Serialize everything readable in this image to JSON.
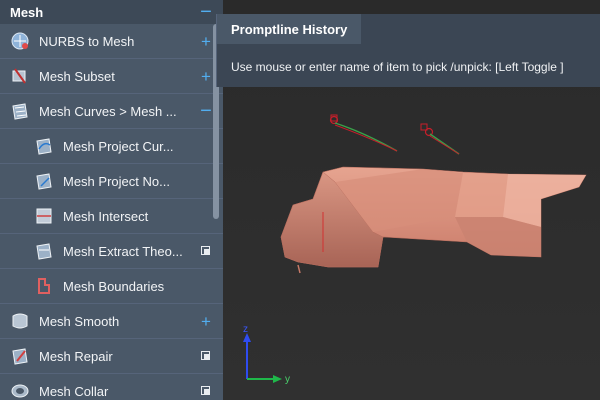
{
  "panel": {
    "title": "Mesh",
    "items": [
      {
        "label": "NURBS to Mesh",
        "action": "plus",
        "icon": "nurbs-to-mesh-icon",
        "sub": false
      },
      {
        "label": "Mesh Subset",
        "action": "plus",
        "icon": "mesh-subset-icon",
        "sub": false
      },
      {
        "label": "Mesh Curves > Mesh ...",
        "action": "minus",
        "icon": "mesh-curves-icon",
        "sub": false
      },
      {
        "label": "Mesh Project Cur...",
        "action": "",
        "icon": "mesh-project-curve-icon",
        "sub": true
      },
      {
        "label": "Mesh Project No...",
        "action": "",
        "icon": "mesh-project-normal-icon",
        "sub": true
      },
      {
        "label": "Mesh Intersect",
        "action": "",
        "icon": "mesh-intersect-icon",
        "sub": true
      },
      {
        "label": "Mesh Extract Theo...",
        "action": "copy",
        "icon": "mesh-extract-icon",
        "sub": true
      },
      {
        "label": "Mesh Boundaries",
        "action": "",
        "icon": "mesh-boundaries-icon",
        "sub": true
      },
      {
        "label": "Mesh Smooth",
        "action": "plus",
        "icon": "mesh-smooth-icon",
        "sub": false
      },
      {
        "label": "Mesh Repair",
        "action": "copy",
        "icon": "mesh-repair-icon",
        "sub": false
      },
      {
        "label": "Mesh Collar",
        "action": "copy",
        "icon": "mesh-collar-icon",
        "sub": false
      }
    ]
  },
  "promptline": {
    "title": "Promptline History",
    "message": "Use mouse or enter name of item to pick /unpick: [Left Toggle ]"
  },
  "axes": {
    "z": "z",
    "y": "y"
  },
  "colors": {
    "panel": "#4a5868",
    "accent": "#52aef0",
    "mesh": "#d98b78"
  }
}
